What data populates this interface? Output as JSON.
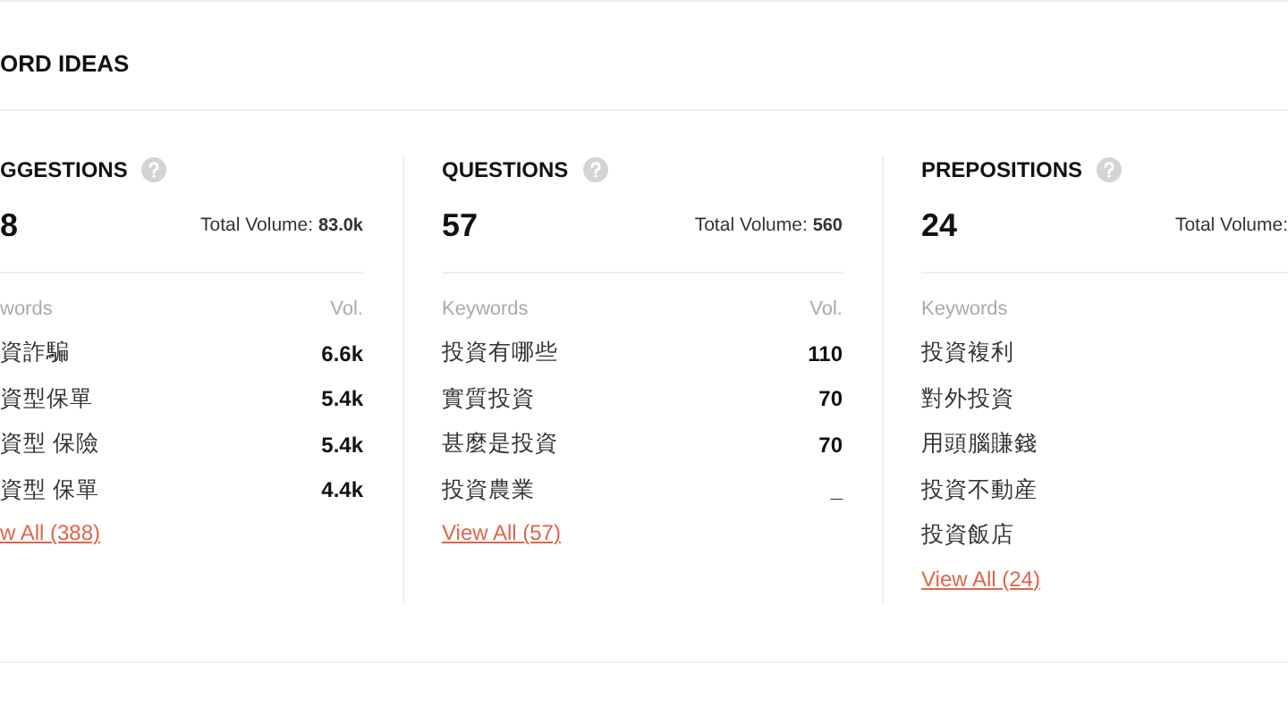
{
  "title": "ORD IDEAS",
  "columns": [
    {
      "heading": "GGESTIONS",
      "count": "8",
      "total_label": "Total Volume:",
      "total_value": "83.0k",
      "keywords_label": "words",
      "vol_label": "Vol.",
      "rows": [
        {
          "keyword": "資詐騙",
          "volume": "6.6k"
        },
        {
          "keyword": "資型保單",
          "volume": "5.4k"
        },
        {
          "keyword": "資型 保險",
          "volume": "5.4k"
        },
        {
          "keyword": "資型 保單",
          "volume": "4.4k"
        }
      ],
      "view_all": "w All (388)"
    },
    {
      "heading": "QUESTIONS",
      "count": "57",
      "total_label": "Total Volume:",
      "total_value": "560",
      "keywords_label": "Keywords",
      "vol_label": "Vol.",
      "rows": [
        {
          "keyword": "投資有哪些",
          "volume": "110"
        },
        {
          "keyword": "實質投資",
          "volume": "70"
        },
        {
          "keyword": "甚麼是投資",
          "volume": "70"
        },
        {
          "keyword": "投資農業",
          "volume": "_"
        }
      ],
      "view_all": "View All (57)"
    },
    {
      "heading": "PREPOSITIONS",
      "count": "24",
      "total_label": "Total Volume:",
      "keywords_label": "Keywords",
      "rows": [
        {
          "keyword": "投資複利"
        },
        {
          "keyword": "對外投資"
        },
        {
          "keyword": "用頭腦賺錢"
        },
        {
          "keyword": "投資不動産"
        },
        {
          "keyword": "投資飯店"
        }
      ],
      "view_all": "View All (24)"
    }
  ]
}
